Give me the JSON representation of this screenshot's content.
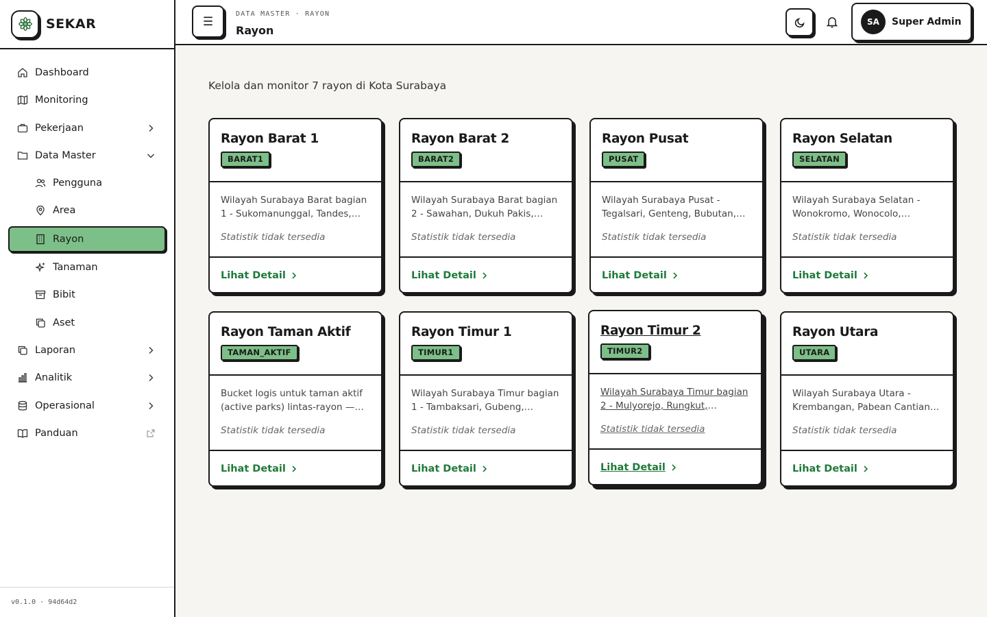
{
  "app": {
    "name": "SEKAR",
    "version": "v0.1.0 · 94d64d2"
  },
  "sidebar": {
    "items": [
      {
        "label": "Dashboard",
        "icon": "home-icon"
      },
      {
        "label": "Monitoring",
        "icon": "map-icon"
      },
      {
        "label": "Pekerjaan",
        "icon": "briefcase-icon",
        "expandable": true
      },
      {
        "label": "Data Master",
        "icon": "folder-icon",
        "expanded": true
      },
      {
        "label": "Pengguna",
        "icon": "users-icon",
        "sub": true
      },
      {
        "label": "Area",
        "icon": "map-pin-icon",
        "sub": true
      },
      {
        "label": "Rayon",
        "icon": "building-icon",
        "sub": true,
        "active": true
      },
      {
        "label": "Tanaman",
        "icon": "sparkles-icon",
        "sub": true
      },
      {
        "label": "Bibit",
        "icon": "archive-icon",
        "sub": true
      },
      {
        "label": "Aset",
        "icon": "copy-icon",
        "sub": true
      },
      {
        "label": "Laporan",
        "icon": "copy-icon",
        "expandable": true
      },
      {
        "label": "Analitik",
        "icon": "bar-chart-icon",
        "expandable": true
      },
      {
        "label": "Operasional",
        "icon": "database-icon",
        "expandable": true
      },
      {
        "label": "Panduan",
        "icon": "book-icon",
        "external": true
      }
    ]
  },
  "header": {
    "breadcrumb": "DATA MASTER · RAYON",
    "title": "Rayon",
    "user": {
      "initials": "SA",
      "name": "Super Admin"
    }
  },
  "main": {
    "subtitle": "Kelola dan monitor 7 rayon di Kota Surabaya",
    "link_label": "Lihat Detail",
    "cards": [
      {
        "name": "Rayon Barat 1",
        "code": "BARAT1",
        "desc": "Wilayah Surabaya Barat bagian 1 - Sukomanunggal, Tandes, Asemrowo",
        "stat": "Statistik tidak tersedia"
      },
      {
        "name": "Rayon Barat 2",
        "code": "BARAT2",
        "desc": "Wilayah Surabaya Barat bagian 2 - Sawahan, Dukuh Pakis, Wiyung",
        "stat": "Statistik tidak tersedia"
      },
      {
        "name": "Rayon Pusat",
        "code": "PUSAT",
        "desc": "Wilayah Surabaya Pusat - Tegalsari, Genteng, Bubutan, Simokerto",
        "stat": "Statistik tidak tersedia"
      },
      {
        "name": "Rayon Selatan",
        "code": "SELATAN",
        "desc": "Wilayah Surabaya Selatan - Wonokromo, Wonocolo, Gayungan",
        "stat": "Statistik tidak tersedia"
      },
      {
        "name": "Rayon Taman Aktif",
        "code": "TAMAN_AKTIF",
        "desc": "Bucket logis untuk taman aktif (active parks) lintas-rayon — dikelola terpisah",
        "stat": "Statistik tidak tersedia"
      },
      {
        "name": "Rayon Timur 1",
        "code": "TIMUR1",
        "desc": "Wilayah Surabaya Timur bagian 1 - Tambaksari, Gubeng, Sukolilo",
        "stat": "Statistik tidak tersedia"
      },
      {
        "name": "Rayon Timur 2",
        "code": "TIMUR2",
        "desc": "Wilayah Surabaya Timur bagian 2 - Mulyorejo, Rungkut, Tenggilis",
        "stat": "Statistik tidak tersedia",
        "hover": true
      },
      {
        "name": "Rayon Utara",
        "code": "UTARA",
        "desc": "Wilayah Surabaya Utara - Krembangan, Pabean Cantian, Semampir",
        "stat": "Statistik tidak tersedia"
      }
    ]
  },
  "colors": {
    "accent": "#7dbf88",
    "link": "#1f7a3a",
    "border": "#1a1a1a",
    "background": "#f6f5f1"
  }
}
